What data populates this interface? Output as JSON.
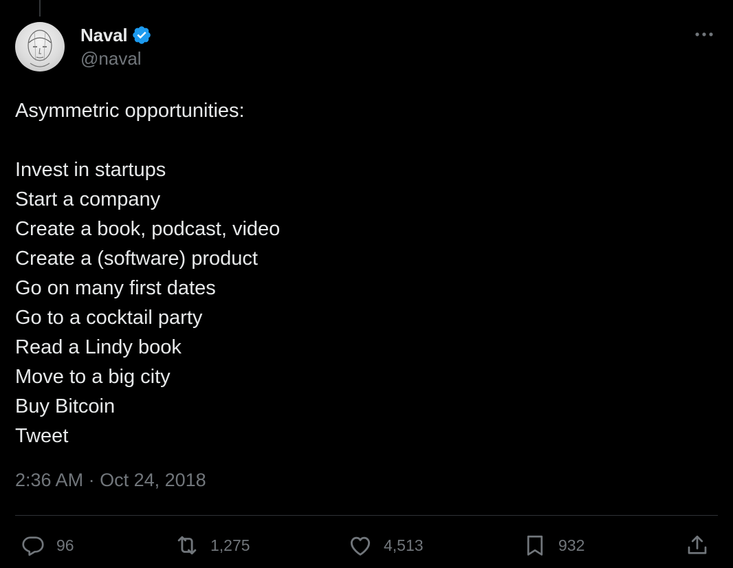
{
  "author": {
    "display_name": "Naval",
    "handle": "@naval",
    "verified": true
  },
  "tweet": {
    "lines": [
      "Asymmetric opportunities:",
      "",
      "Invest in startups",
      "Start a company",
      "Create a book, podcast, video",
      "Create a (software) product",
      "Go on many first dates",
      "Go to a cocktail party",
      "Read a Lindy book",
      "Move to a big city",
      "Buy Bitcoin",
      "Tweet"
    ],
    "time": "2:36 AM",
    "separator": "·",
    "date": "Oct 24, 2018"
  },
  "actions": {
    "replies": "96",
    "reposts": "1,275",
    "likes": "4,513",
    "bookmarks": "932"
  },
  "icons": {
    "verified": "verified-badge-icon",
    "more": "more-options-icon",
    "reply": "reply-icon",
    "repost": "repost-icon",
    "like": "heart-icon",
    "bookmark": "bookmark-icon",
    "share": "share-icon"
  },
  "colors": {
    "background": "#000000",
    "text_primary": "#e7e9ea",
    "text_secondary": "#71767b",
    "verified_blue": "#1d9bf0",
    "divider": "#2f3336"
  }
}
